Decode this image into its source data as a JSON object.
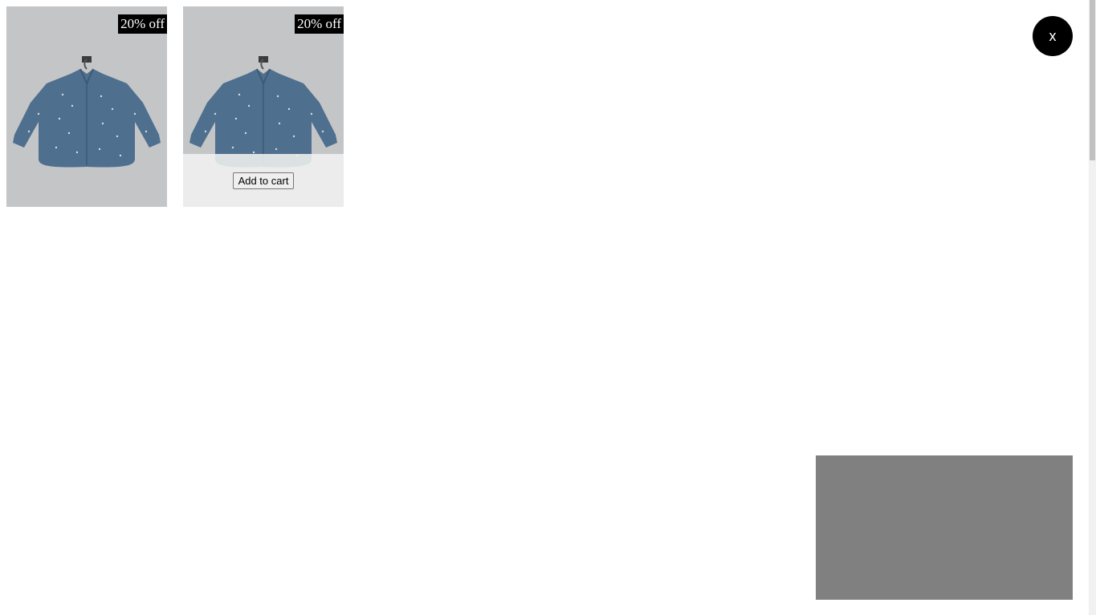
{
  "products": [
    {
      "badge": "20% off",
      "image_icon": "shirt-image",
      "shirt_color": "#4e6f8e"
    },
    {
      "badge": "20% off",
      "image_icon": "shirt-image",
      "shirt_color": "#4e6f8e",
      "add_to_cart_label": "Add to cart"
    }
  ],
  "close_button": {
    "label": "x"
  },
  "colors": {
    "card_background": "#c4c5c7",
    "badge_background": "#000000",
    "close_background": "#000000",
    "panel_background": "#808080"
  }
}
